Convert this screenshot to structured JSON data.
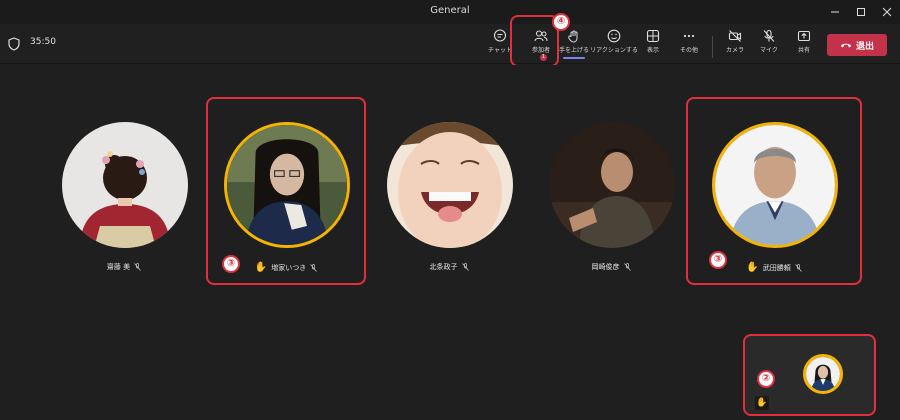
{
  "window": {
    "title": "General"
  },
  "toolbar": {
    "timer": "35:50",
    "chat_label": "チャット",
    "participants_label": "参加者",
    "participants_count": "1",
    "raise_hand_label": "手を上げる",
    "reactions_label": "リアクションする",
    "view_label": "表示",
    "more_label": "その他",
    "camera_label": "カメラ",
    "mic_label": "マイク",
    "share_label": "共有",
    "leave_label": "退出"
  },
  "participants": [
    {
      "name": "齋藤 美",
      "hand_raised": false
    },
    {
      "name": "増家いつき",
      "hand_raised": true
    },
    {
      "name": "北条政子",
      "hand_raised": false
    },
    {
      "name": "岡崎俊彦",
      "hand_raised": false
    },
    {
      "name": "武田勝頼",
      "hand_raised": true
    }
  ],
  "annotations": {
    "participants_marker": "④",
    "tile_marker_1": "③",
    "tile_marker_2": "③",
    "self_marker": "②"
  },
  "self_view": {
    "hand_raised": true
  },
  "colors": {
    "background": "#1f1f1f",
    "raised_hand_ring": "#f5b400",
    "leave_button": "#c4314b",
    "annotation": "#e0303b",
    "accent": "#7b83eb"
  }
}
